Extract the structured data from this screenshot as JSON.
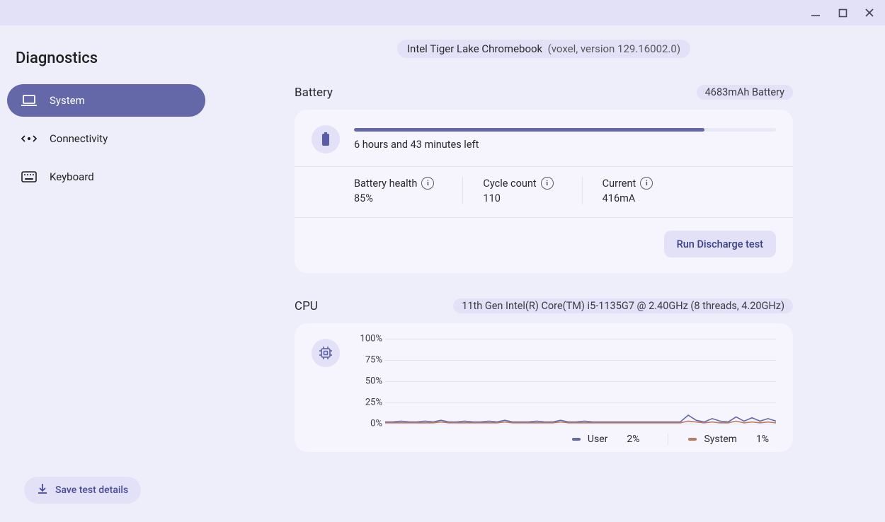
{
  "app_title": "Diagnostics",
  "sidebar": {
    "items": [
      {
        "label": "System"
      },
      {
        "label": "Connectivity"
      },
      {
        "label": "Keyboard"
      }
    ],
    "save_label": "Save test details"
  },
  "device": {
    "name": "Intel Tiger Lake Chromebook",
    "detail": "(voxel, version 129.16002.0)"
  },
  "battery": {
    "section_label": "Battery",
    "chip": "4683mAh Battery",
    "progress_pct": 83,
    "remaining_label": "6 hours and 43 minutes left",
    "stats": {
      "health_label": "Battery health",
      "health_value": "85%",
      "cycle_label": "Cycle count",
      "cycle_value": "110",
      "current_label": "Current",
      "current_value": "416mA"
    },
    "action_label": "Run Discharge test"
  },
  "cpu": {
    "section_label": "CPU",
    "chip": "11th Gen Intel(R) Core(TM) i5-1135G7 @ 2.40GHz (8 threads, 4.20GHz)",
    "legend": {
      "user_label": "User",
      "user_value": "2%",
      "system_label": "System",
      "system_value": "1%"
    }
  },
  "chart_data": {
    "type": "line",
    "title": "",
    "xlabel": "",
    "ylabel": "",
    "ylim": [
      0,
      100
    ],
    "y_ticks": [
      "100%",
      "75%",
      "50%",
      "25%",
      "0%"
    ],
    "x": [
      0,
      1,
      2,
      3,
      4,
      5,
      6,
      7,
      8,
      9,
      10,
      11,
      12,
      13,
      14,
      15,
      16,
      17,
      18,
      19,
      20,
      21,
      22,
      23,
      24,
      25,
      26,
      27,
      28,
      29,
      30,
      31,
      32,
      33,
      34,
      35,
      36,
      37,
      38,
      39,
      40,
      41,
      42,
      43,
      44,
      45,
      46,
      47,
      48,
      49
    ],
    "series": [
      {
        "name": "User",
        "color": "#6467a8",
        "values": [
          2,
          2,
          3,
          2,
          2,
          3,
          2,
          4,
          2,
          2,
          3,
          2,
          2,
          3,
          2,
          4,
          2,
          2,
          2,
          3,
          2,
          2,
          4,
          2,
          2,
          3,
          2,
          2,
          2,
          2,
          2,
          2,
          2,
          2,
          2,
          2,
          2,
          2,
          10,
          4,
          2,
          6,
          3,
          2,
          8,
          3,
          7,
          3,
          6,
          3
        ]
      },
      {
        "name": "System",
        "color": "#b97a5e",
        "values": [
          1,
          1,
          1,
          1,
          1,
          1,
          1,
          2,
          1,
          1,
          1,
          1,
          1,
          1,
          1,
          2,
          1,
          1,
          1,
          1,
          1,
          1,
          2,
          1,
          1,
          1,
          1,
          1,
          1,
          1,
          1,
          1,
          1,
          1,
          1,
          1,
          1,
          1,
          3,
          2,
          1,
          2,
          1,
          1,
          3,
          1,
          2,
          1,
          2,
          1
        ]
      }
    ]
  }
}
